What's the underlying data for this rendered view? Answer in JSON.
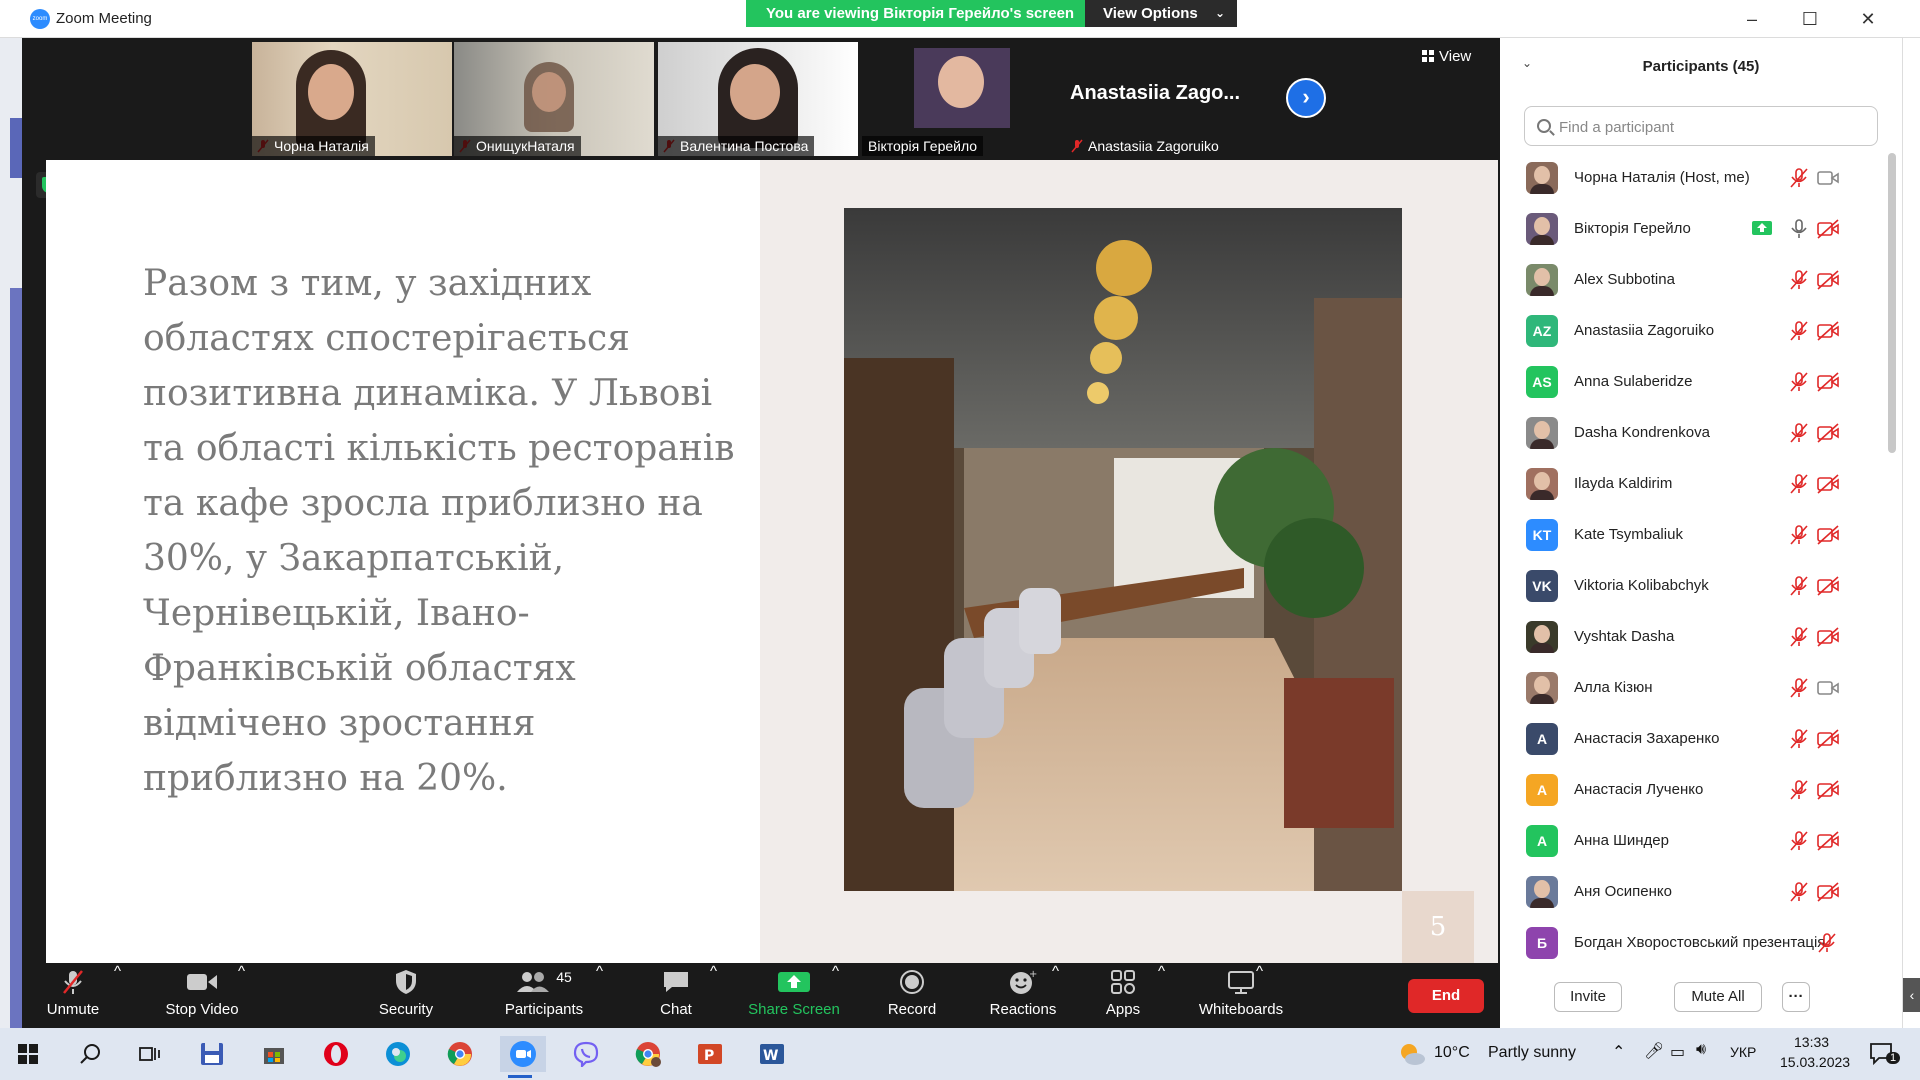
{
  "window": {
    "app_icon": "zoom",
    "title": "Zoom Meeting"
  },
  "banner": {
    "viewing_text": "You are viewing Вікторія Герейло's screen",
    "view_options": "View Options"
  },
  "gallery": {
    "thumbnails": [
      {
        "name": "Чорна Наталія",
        "muted": true
      },
      {
        "name": "ОнищукНаталя",
        "muted": true
      },
      {
        "name": "Валентина Постова",
        "muted": true
      },
      {
        "name": "Вікторія Герейло",
        "muted": false,
        "active": true
      },
      {
        "name": "Anastasiia Zagoruiko",
        "big_name": "Anastasiia  Zago...",
        "muted": true
      }
    ],
    "view_label": "View"
  },
  "slide": {
    "text": "Разом з тим, у західних областях спостерігається позитивна динаміка. У Львові та області кількість ресторанів та кафе зросла приблизно на 30%, у Закарпатській, Чернівецькій, Івано-Франківській областях відмічено зростання приблизно на 20%.",
    "page_number": "5"
  },
  "toolbar": {
    "unmute": "Unmute",
    "stop_video": "Stop Video",
    "security": "Security",
    "participants": "Participants",
    "participants_count": "45",
    "chat": "Chat",
    "share_screen": "Share Screen",
    "record": "Record",
    "reactions": "Reactions",
    "apps": "Apps",
    "whiteboards": "Whiteboards",
    "end": "End"
  },
  "panel": {
    "title": "Participants (45)",
    "search_placeholder": "Find a participant",
    "participants": [
      {
        "name": "Чорна Наталія (Host, me)",
        "initials": "",
        "avatar_color": "#8a6a5a",
        "mic": "muted",
        "video": "on"
      },
      {
        "name": "Вікторія Герейло",
        "initials": "",
        "avatar_color": "#6a5a7a",
        "mic": "on",
        "video": "off",
        "sharing": true
      },
      {
        "name": "Alex Subbotina",
        "initials": "",
        "avatar_color": "#7a8a6a",
        "mic": "muted",
        "video": "off"
      },
      {
        "name": "Anastasiia Zagoruiko",
        "initials": "AZ",
        "avatar_color": "#2fb77a",
        "mic": "muted",
        "video": "off"
      },
      {
        "name": "Anna Sulaberidze",
        "initials": "AS",
        "avatar_color": "#23c45e",
        "mic": "muted",
        "video": "off"
      },
      {
        "name": "Dasha Kondrenkova",
        "initials": "",
        "avatar_color": "#8a8a8a",
        "mic": "muted",
        "video": "off"
      },
      {
        "name": "Ilayda Kaldirim",
        "initials": "",
        "avatar_color": "#a07060",
        "mic": "muted",
        "video": "off"
      },
      {
        "name": "Kate Tsymbaliuk",
        "initials": "KT",
        "avatar_color": "#2d8cff",
        "mic": "muted",
        "video": "off"
      },
      {
        "name": "Viktoria Kolibabchyk",
        "initials": "VK",
        "avatar_color": "#3a4a6a",
        "mic": "muted",
        "video": "off"
      },
      {
        "name": "Vyshtak Dasha",
        "initials": "",
        "avatar_color": "#3a3a2a",
        "mic": "muted",
        "video": "off"
      },
      {
        "name": "Алла Кізюн",
        "initials": "",
        "avatar_color": "#9a7a6a",
        "mic": "muted",
        "video": "on"
      },
      {
        "name": "Анастасія Захаренко",
        "initials": "A",
        "avatar_color": "#3a4a6a",
        "mic": "muted",
        "video": "off"
      },
      {
        "name": "Анастасія Лученко",
        "initials": "A",
        "avatar_color": "#f5a623",
        "mic": "muted",
        "video": "off"
      },
      {
        "name": "Анна Шиндер",
        "initials": "A",
        "avatar_color": "#23c45e",
        "mic": "muted",
        "video": "off"
      },
      {
        "name": "Аня Осипенко",
        "initials": "",
        "avatar_color": "#6a7a9a",
        "mic": "muted",
        "video": "off"
      },
      {
        "name": "Богдан Хворостовський презентація",
        "initials": "Б",
        "avatar_color": "#8e44ad",
        "mic": "muted",
        "video": "none"
      }
    ],
    "invite": "Invite",
    "mute_all": "Mute All",
    "more": "···"
  },
  "taskbar": {
    "weather_temp": "10°C",
    "weather_desc": "Partly sunny",
    "language": "УКР",
    "time": "13:33",
    "date": "15.03.2023",
    "notification_count": "1"
  },
  "colors": {
    "accent_blue": "#2d8cff",
    "green": "#23c45e",
    "end_red": "#e02828",
    "muted_red": "#e02828"
  }
}
